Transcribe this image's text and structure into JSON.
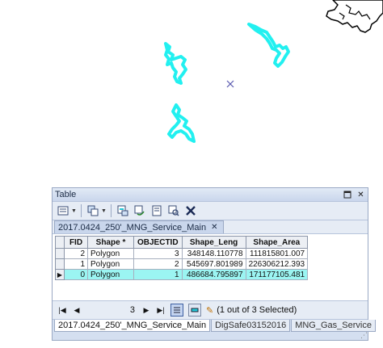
{
  "table_window": {
    "title": "Table",
    "layer_title": "2017.0424_250'_MNG_Service_Main",
    "columns": [
      "FID",
      "Shape *",
      "OBJECTID",
      "Shape_Leng",
      "Shape_Area"
    ],
    "rows": [
      {
        "fid": "2",
        "shape": "Polygon",
        "objectid": "3",
        "shape_leng": "348148.110778",
        "shape_area": "111815801.007",
        "selected": false
      },
      {
        "fid": "1",
        "shape": "Polygon",
        "objectid": "2",
        "shape_leng": "545697.801989",
        "shape_area": "226306212.393",
        "selected": false
      },
      {
        "fid": "0",
        "shape": "Polygon",
        "objectid": "1",
        "shape_leng": "486684.795897",
        "shape_area": "171177105.481",
        "selected": true
      }
    ],
    "current_record": "3",
    "selection_status": "(1 out of 3 Selected)",
    "tabs": [
      {
        "label": "2017.0424_250'_MNG_Service_Main",
        "active": true
      },
      {
        "label": "DigSafe03152016",
        "active": false
      },
      {
        "label": "MNG_Gas_Service",
        "active": false
      }
    ]
  },
  "colors": {
    "polygon_cyan": "#22f0f0",
    "selection_highlight": "#9bf5f2",
    "dark_feature": "#000000",
    "map_marker": "#5a5ab0"
  },
  "icons": {
    "table_options": "table-options-icon",
    "related_tables": "related-tables-icon",
    "select_by_attributes": "select-by-attributes-icon",
    "switch_selection": "switch-selection-icon",
    "clear_selection": "clear-selection-icon",
    "zoom_to_selected": "zoom-to-selected-icon",
    "delete_selected": "delete-selected-icon"
  }
}
